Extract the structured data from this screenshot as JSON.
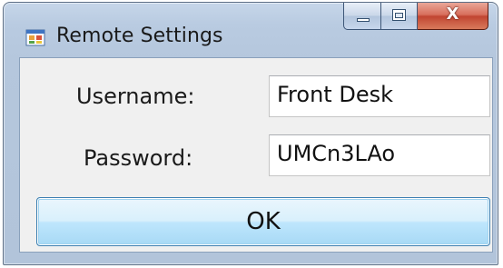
{
  "window": {
    "title": "Remote Settings",
    "icon": "winforms-app-icon",
    "buttons": {
      "minimize_icon": "minimize-icon",
      "maximize_icon": "maximize-icon",
      "close_glyph": "X"
    }
  },
  "form": {
    "username_label": "Username:",
    "username_value": "Front Desk",
    "password_label": "Password:",
    "password_value": "UMCn3LAo",
    "ok_label": "OK"
  },
  "colors": {
    "frame": "#b9cbe1",
    "client": "#f0f0f0",
    "close_button": "#c14531",
    "ok_button": "#bee6fd"
  }
}
